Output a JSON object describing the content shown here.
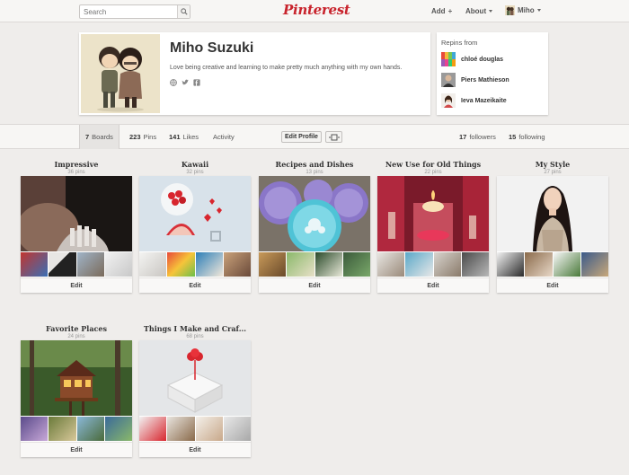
{
  "nav": {
    "search_placeholder": "Search",
    "logo": "Pinterest",
    "add_label": "Add",
    "about_label": "About",
    "user_label": "Miho"
  },
  "profile": {
    "name": "Miho Suzuki",
    "bio": "Love being creative and learning to make pretty much anything with my own hands.",
    "social_icons": [
      "website-icon",
      "twitter-icon",
      "facebook-icon"
    ]
  },
  "repins": {
    "title": "Repins from",
    "users": [
      {
        "name": "chloé douglas"
      },
      {
        "name": "Piers Mathieson"
      },
      {
        "name": "Ieva Mazeikaite"
      }
    ]
  },
  "tabs": {
    "boards_count": "7",
    "boards_label": "Boards",
    "pins_count": "223",
    "pins_label": "Pins",
    "likes_count": "141",
    "likes_label": "Likes",
    "activity_label": "Activity",
    "edit_profile": "Edit Profile",
    "followers_count": "17",
    "followers_label": "followers",
    "following_count": "15",
    "following_label": "following"
  },
  "boards": [
    {
      "title": "Impressive",
      "count": "36 pins",
      "edit": "Edit"
    },
    {
      "title": "Kawaii",
      "count": "32 pins",
      "edit": "Edit"
    },
    {
      "title": "Recipes and Dishes",
      "count": "13 pins",
      "edit": "Edit"
    },
    {
      "title": "New Use for Old Things",
      "count": "22 pins",
      "edit": "Edit"
    },
    {
      "title": "My Style",
      "count": "27 pins",
      "edit": "Edit"
    },
    {
      "title": "Favorite Places",
      "count": "24 pins",
      "edit": "Edit"
    },
    {
      "title": "Things I Make and Craf...",
      "count": "68 pins",
      "edit": "Edit"
    }
  ],
  "colors": {
    "brand": "#c8232c",
    "background": "#efedeb"
  }
}
